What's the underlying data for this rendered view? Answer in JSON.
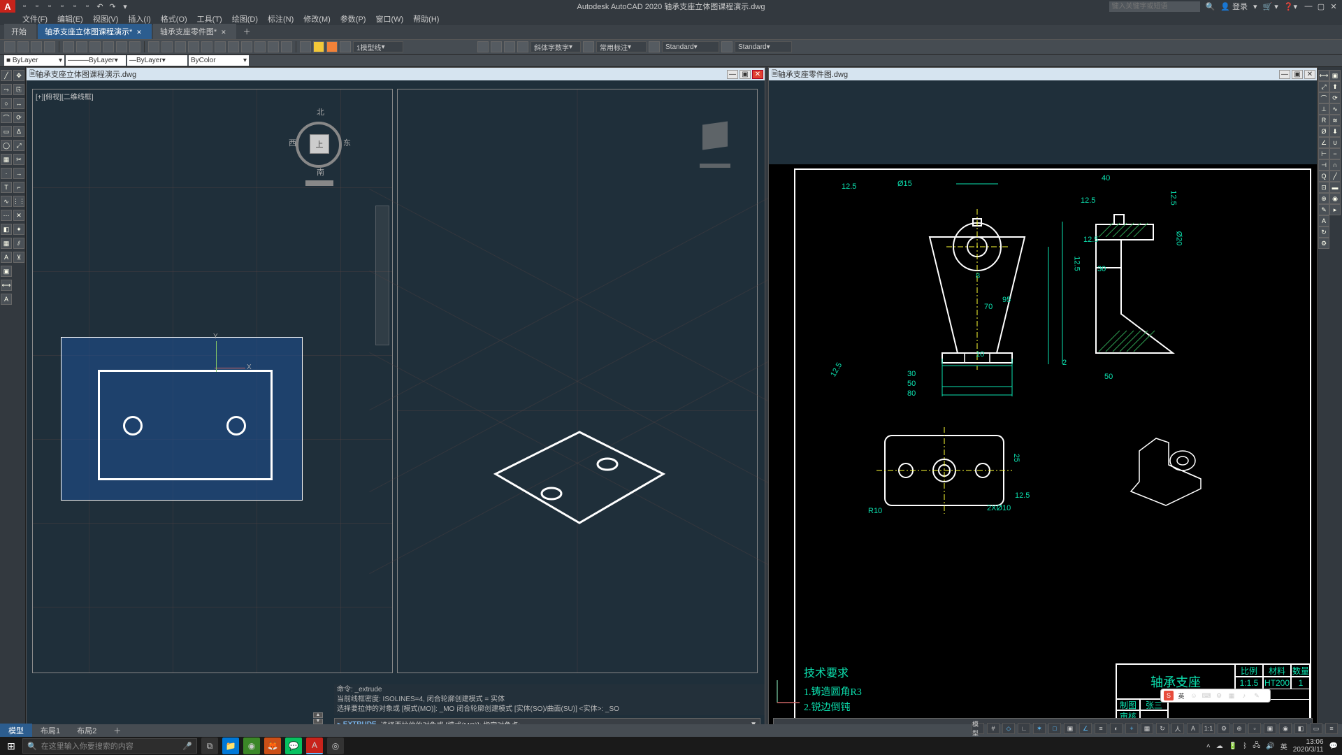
{
  "app": {
    "title": "Autodesk AutoCAD 2020    轴承支座立体图课程演示.dwg",
    "search_placeholder": "键入关键字或短语",
    "login": "登录"
  },
  "menu": [
    "文件(F)",
    "编辑(E)",
    "视图(V)",
    "插入(I)",
    "格式(O)",
    "工具(T)",
    "绘图(D)",
    "标注(N)",
    "修改(M)",
    "参数(P)",
    "窗口(W)",
    "帮助(H)"
  ],
  "doctabs": {
    "items": [
      "开始",
      "轴承支座立体图课程演示*",
      "轴承支座零件图*"
    ],
    "active": 1
  },
  "ribbon": {
    "layer_combo": "1模型线",
    "dim_style1": "斜体字数字",
    "dim_style2": "常用标注",
    "std1": "Standard",
    "std2": "Standard"
  },
  "properties": {
    "color": "ByLayer",
    "ltype": "ByLayer",
    "lweight": "ByLayer",
    "plot": "ByColor"
  },
  "vp_left": {
    "title": " 轴承支座立体图课程演示.dwg",
    "label": "[+][俯视][二维线框]",
    "compass": {
      "n": "北",
      "s": "南",
      "e": "东",
      "w": "西",
      "face": "上"
    }
  },
  "vp_right": {
    "title": " 轴承支座零件图.dwg"
  },
  "cmd": {
    "hist1": "命令: _extrude",
    "hist2": "当前线框密度:  ISOLINES=4, 闭合轮廓创建模式 = 实体",
    "hist3": "选择要拉伸的对象或 [模式(MO)]: _MO 闭合轮廓创建模式 [实体(SO)/曲面(SU)] <实体>: _SO",
    "prompt": "▸ EXTRUDE",
    "body": "选择要拉伸的对象或 [模式(MO)]: 指定对角点:"
  },
  "bottom_tabs": [
    "模型",
    "布局1",
    "布局2"
  ],
  "bottom_active": 0,
  "taskbar": {
    "search": "在这里输入你要搜索的内容",
    "time": "13:06",
    "date": "2020/3/11"
  },
  "drawing": {
    "tech_title": "技术要求",
    "tech_l1": "1.铸造圆角R3",
    "tech_l2": "2.锐边倒钝",
    "tb_title": "轴承支座",
    "tb_scale_h": "比例",
    "tb_scale": "1:1.5",
    "tb_mat_h": "材料",
    "tb_mat": "HT200",
    "tb_qty_h": "数量",
    "tb_qty": "1",
    "tb_drawby_h": "制图",
    "tb_drawby": "张三",
    "tb_check_h": "审核",
    "dims": {
      "d15": "Ø15",
      "d20": "Ø20",
      "w80": "80",
      "w50": "50",
      "w30": "30",
      "h95": "95",
      "h70": "70",
      "h8": "8",
      "h10": "10",
      "r125_1": "12.5",
      "r125_2": "12.5",
      "r125_3": "12.5",
      "r125_4": "12.5",
      "r125_5": "12.5",
      "top40": "40",
      "right30": "30",
      "right50": "50",
      "h2": "2",
      "h25": "25",
      "r10": "R10",
      "holes": "2XØ10"
    }
  },
  "statusbar": {
    "model": "模型",
    "zoom": "1:1"
  },
  "ime": {
    "label": "英"
  }
}
